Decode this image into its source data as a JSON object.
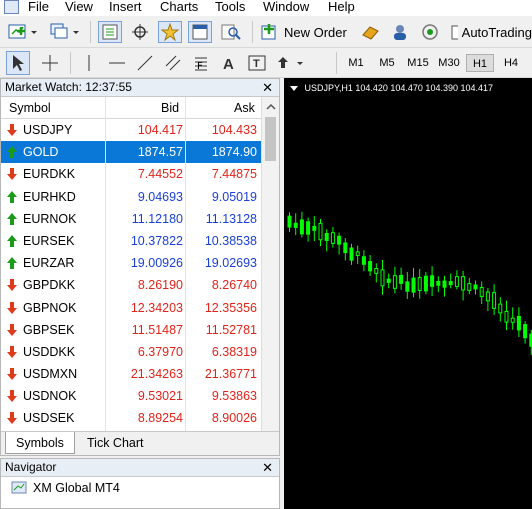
{
  "menu": [
    "File",
    "View",
    "Insert",
    "Charts",
    "Tools",
    "Window",
    "Help"
  ],
  "toolbar": {
    "new_order_label": "New Order",
    "autotrading_label": "AutoTrading",
    "timeframes": [
      "M1",
      "M5",
      "M15",
      "M30",
      "H1",
      "H4"
    ],
    "active_timeframe": "H1"
  },
  "market_watch": {
    "title": "Market Watch: 12:37:55",
    "columns": {
      "symbol": "Symbol",
      "bid": "Bid",
      "ask": "Ask"
    },
    "rows": [
      {
        "symbol": "USDJPY",
        "bid": "104.417",
        "ask": "104.433",
        "dir": "down",
        "color": "red"
      },
      {
        "symbol": "GOLD",
        "bid": "1874.57",
        "ask": "1874.90",
        "dir": "up",
        "color": "selected"
      },
      {
        "symbol": "EURDKK",
        "bid": "7.44552",
        "ask": "7.44875",
        "dir": "down",
        "color": "red"
      },
      {
        "symbol": "EURHKD",
        "bid": "9.04693",
        "ask": "9.05019",
        "dir": "up",
        "color": "blue"
      },
      {
        "symbol": "EURNOK",
        "bid": "11.12180",
        "ask": "11.13128",
        "dir": "up",
        "color": "blue"
      },
      {
        "symbol": "EURSEK",
        "bid": "10.37822",
        "ask": "10.38538",
        "dir": "up",
        "color": "blue"
      },
      {
        "symbol": "EURZAR",
        "bid": "19.00926",
        "ask": "19.02693",
        "dir": "up",
        "color": "blue"
      },
      {
        "symbol": "GBPDKK",
        "bid": "8.26190",
        "ask": "8.26740",
        "dir": "down",
        "color": "red"
      },
      {
        "symbol": "GBPNOK",
        "bid": "12.34203",
        "ask": "12.35356",
        "dir": "down",
        "color": "red"
      },
      {
        "symbol": "GBPSEK",
        "bid": "11.51487",
        "ask": "11.52781",
        "dir": "down",
        "color": "red"
      },
      {
        "symbol": "USDDKK",
        "bid": "6.37970",
        "ask": "6.38319",
        "dir": "down",
        "color": "red"
      },
      {
        "symbol": "USDMXN",
        "bid": "21.34263",
        "ask": "21.36771",
        "dir": "down",
        "color": "red"
      },
      {
        "symbol": "USDNOK",
        "bid": "9.53021",
        "ask": "9.53863",
        "dir": "down",
        "color": "red"
      },
      {
        "symbol": "USDSEK",
        "bid": "8.89254",
        "ask": "8.90026",
        "dir": "down",
        "color": "red"
      }
    ],
    "tabs": [
      "Symbols",
      "Tick Chart"
    ],
    "active_tab": "Symbols"
  },
  "navigator": {
    "title": "Navigator",
    "root_item": "XM Global MT4"
  },
  "chart": {
    "info": "USDJPY,H1  104.420 104.470 104.390 104.417"
  },
  "colors": {
    "up": "#1a9b1a",
    "down": "#e03a1c",
    "bid_red": "#e0241a",
    "bid_blue": "#1a3fd6",
    "selected": "#0a78d7",
    "candle": "#00ff00"
  }
}
